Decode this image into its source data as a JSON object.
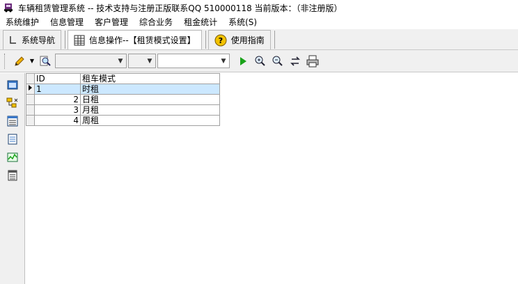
{
  "window": {
    "title": "车辆租赁管理系统 -- 技术支持与注册正版联系QQ 510000118    当前版本：（非注册版）"
  },
  "menu": [
    "系统维护",
    "信息管理",
    "客户管理",
    "综合业务",
    "租金统计",
    "系统(S)"
  ],
  "tabs": [
    {
      "label": "系统导航",
      "icon": "navigator-icon"
    },
    {
      "label": "信息操作--【租赁模式设置】",
      "icon": "grid-icon"
    },
    {
      "label": "使用指南",
      "icon": "help-icon"
    }
  ],
  "toolbar": {
    "combo1_value": "",
    "combo2_value": "",
    "combo3_value": "",
    "icons": [
      "pencil-icon",
      "magnifier-doc-icon",
      "run-icon",
      "search-plus-icon",
      "search-minus-icon",
      "refresh-icon",
      "print-icon"
    ]
  },
  "sidebar_icons": [
    "window-icon",
    "tree-icon",
    "form-icon",
    "document-icon",
    "chart-icon",
    "report-icon"
  ],
  "grid": {
    "columns": [
      "ID",
      "租车模式"
    ],
    "rows": [
      {
        "id": "1",
        "mode": "时租",
        "selected": true
      },
      {
        "id": "2",
        "mode": "日租",
        "selected": false
      },
      {
        "id": "3",
        "mode": "月租",
        "selected": false
      },
      {
        "id": "4",
        "mode": "周租",
        "selected": false
      }
    ]
  },
  "colors": {
    "selection": "#cce8ff",
    "toolbar_bg": "#f0f0f0",
    "run_green": "#1aa31a"
  }
}
